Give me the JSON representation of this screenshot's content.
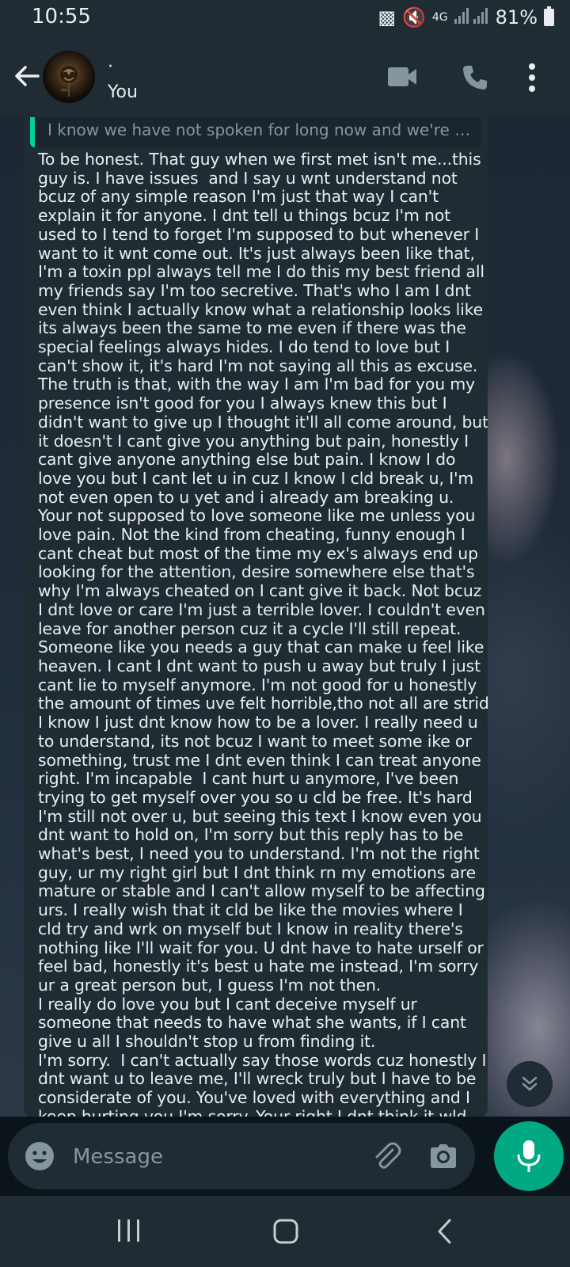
{
  "status_bar": {
    "time": "10:55",
    "network": "4G",
    "battery": "81%"
  },
  "header": {
    "name": "·",
    "subtitle": "You"
  },
  "message": {
    "quoted_text": "I know we have not spoken for long now and we're no lo...",
    "body": "To be honest. That guy when we first met isn't me...this guy is. I have issues  and I say u wnt understand not bcuz of any simple reason I'm just that way I can't explain it for anyone. I dnt tell u things bcuz I'm not used to I tend to forget I'm supposed to but whenever I want to it wnt come out. It's just always been like that, I'm a toxin ppl always tell me I do this my best friend all my friends say I'm too secretive. That's who I am I dnt  even think I actually know what a relationship looks like its always been the same to me even if there was the special feelings always hides. I do tend to love but I can't show it, it's hard I'm not saying all this as excuse. The truth is that, with the way I am I'm bad for you my presence isn't good for you I always knew this but I didn't want to give up I thought it'll all come around, but it doesn't I cant give you anything but pain, honestly I cant give anyone anything else but pain. I know I do love you but I cant let u in cuz I know I cld break u, I'm not even open to u yet and i already am breaking u. Your not supposed to love someone like me unless you love pain. Not the kind from cheating, funny enough I cant cheat but most of the time my ex's always end up looking for the attention, desire somewhere else that's why I'm always cheated on I cant give it back. Not bcuz I dnt love or care I'm just a terrible lover. I couldn't even leave for another person cuz it a cycle I'll still repeat. Someone like you needs a guy that can make u feel like heaven. I cant I dnt want to push u away but truly I just cant lie to myself anymore. I'm not good for u honestly the amount of times uve felt horrible,tho not all are strid I know I just dnt know how to be a lover. I really need u to understand, its not bcuz I want to meet some ike or something, trust me I dnt even think I can treat anyone right. I'm incapable  I cant hurt u anymore, I've been trying to get myself over you so u cld be free. It's hard I'm still not over u, but seeing this text I know even you dnt want to hold on, I'm sorry but this reply has to be what's best, I need you to understand. I'm not the right guy, ur my right girl but I dnt think rn my emotions are mature or stable and I can't allow myself to be affecting urs. I really wish that it cld be like the movies where I cld try and wrk on myself but I know in reality there's nothing like I'll wait for you. U dnt have to hate urself or feel bad, honestly it's best u hate me instead, I'm sorry ur a great person but, I guess I'm not then.\nI really do love you but I cant deceive myself ur someone that needs to have what she wants, if I cant give u all I shouldn't stop u from finding it.\nI'm sorry.  I can't actually say those words cuz honestly I dnt want u to leave me, I'll wreck truly but I have to be considerate of you. You've loved with everything and I keep hurting you I'm sorry. Your right I dnt think it wld really work out"
  },
  "input": {
    "placeholder": "Message",
    "value": ""
  },
  "icons": {
    "back": "arrow-left-icon",
    "video": "video-call-icon",
    "voice": "phone-icon",
    "menu": "more-vertical-icon",
    "emoji": "emoji-icon",
    "attach": "paperclip-icon",
    "camera": "camera-icon",
    "mic": "microphone-icon",
    "scroll": "double-chevron-down-icon"
  },
  "colors": {
    "accent": "#00a884",
    "quote_bar": "#06cf9c",
    "bubble": "#1f2c34",
    "bar": "#1f2c34"
  }
}
